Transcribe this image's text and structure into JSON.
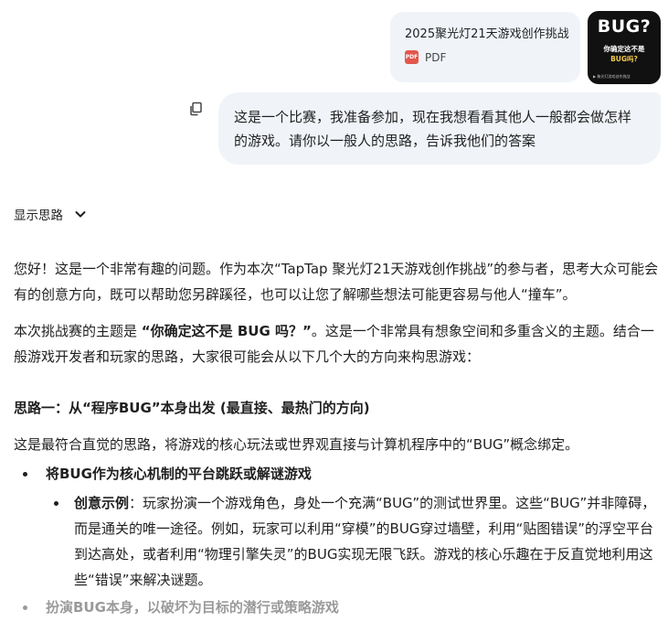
{
  "attachment": {
    "file_name": "2025聚光灯21天游戏创作挑战",
    "file_type": "PDF",
    "pdf_badge": "PDF",
    "thumbnail": {
      "title": "BUG?",
      "subtitle_line1": "你确定这不是",
      "subtitle_line2": "BUG吗?",
      "footer": "▶ 聚光灯游戏创作挑战"
    }
  },
  "user_message": {
    "text": "这是一个比赛，我准备参加，现在我想看看其他人一般都会做怎样的游戏。请你以一般人的思路，告诉我他们的答案"
  },
  "thoughts": {
    "label": "显示思路"
  },
  "response": {
    "intro": "您好！这是一个非常有趣的问题。作为本次“TapTap 聚光灯21天游戏创作挑战”的参与者，思考大众可能会有的创意方向，既可以帮助您另辟蹊径，也可以让您了解哪些想法可能更容易与他人“撞车”。",
    "theme_prefix": "本次挑战赛的主题是 ",
    "theme_bold": "“你确定这不是 BUG 吗？”",
    "theme_suffix": "。这是一个非常具有想象空间和多重含义的主题。结合一般游戏开发者和玩家的思路，大家很可能会从以下几个大的方向来构思游戏：",
    "heading1": "思路一：从“程序BUG”本身出发 (最直接、最热门的方向)",
    "desc1": "这是最符合直觉的思路，将游戏的核心玩法或世界观直接与计算机程序中的“BUG”概念绑定。",
    "bullet1": "将BUG作为核心机制的平台跳跃或解谜游戏",
    "example_label": "创意示例",
    "example_text": "：玩家扮演一个游戏角色，身处一个充满“BUG”的测试世界里。这些“BUG”并非障碍，而是通关的唯一途径。例如，玩家可以利用“穿模”的BUG穿过墙壁，利用“贴图错误”的浮空平台到达高处，或者利用“物理引擎失灵”的BUG实现无限飞跃。游戏的核心乐趣在于反直觉地利用这些“错误”来解决谜题。",
    "bullet2": "扮演BUG本身，以破坏为目标的潜行或策略游戏"
  }
}
